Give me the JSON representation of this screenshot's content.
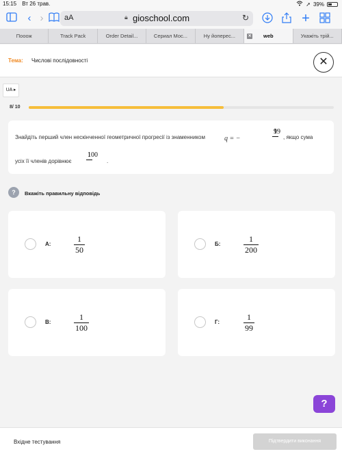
{
  "status_bar": {
    "time": "15:15",
    "date": "Вт 26 трав.",
    "battery": "39%"
  },
  "browser": {
    "text_size_label": "aA",
    "url": "gioschool.com",
    "tabs": [
      {
        "label": "Пооож"
      },
      {
        "label": "Track Pack"
      },
      {
        "label": "Order Detail..."
      },
      {
        "label": "Сериал Мос..."
      },
      {
        "label": "Ну йоперес..."
      },
      {
        "label": "web",
        "active": true
      },
      {
        "label": "Укажіть трій..."
      }
    ]
  },
  "topic": {
    "label": "Тема:",
    "value": "Числові послідовності"
  },
  "lang": "UA",
  "progress": {
    "text": "8/ 10",
    "current": 8,
    "total": 10
  },
  "question": {
    "part1": "Знайдіть перший член нескінченної геометричної прогресії із знаменником",
    "q_var": "q = −",
    "q_num": "1",
    "q_den": "99",
    "part2": ", якщо сума",
    "part3": "усіх її членів дорівнює",
    "s_num": "1",
    "s_den": "100",
    "part4": "."
  },
  "hint": "Вкажіть правильну відповідь",
  "answers": [
    {
      "letter": "А:",
      "num": "1",
      "den": "50"
    },
    {
      "letter": "Б:",
      "num": "1",
      "den": "200"
    },
    {
      "letter": "В:",
      "num": "1",
      "den": "100"
    },
    {
      "letter": "Г:",
      "num": "1",
      "den": "99"
    }
  ],
  "help_label": "?",
  "footer": {
    "left": "Вхідне тестування",
    "submit": "Підтвердити виконання"
  },
  "colors": {
    "accent_orange": "#f08a24",
    "progress_fill": "#f6be3b",
    "help_purple": "#8b45d8",
    "browser_blue": "#2f7cf6"
  }
}
